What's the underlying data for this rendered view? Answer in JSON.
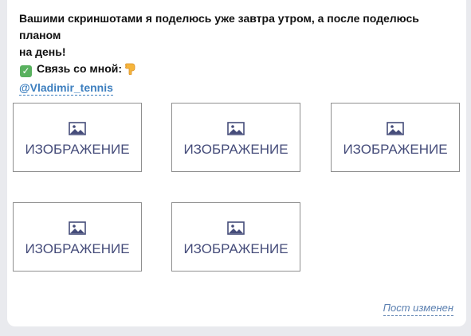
{
  "post": {
    "text_line1": "Вашими скриншотами я поделюсь уже завтра утром, а после поделюсь планом",
    "text_line2": "на день!",
    "contact_label": "Связь со мной:",
    "mention": "@Vladimir_tennis",
    "check_icon": "white-check-mark-icon",
    "hand_icon": "backhand-index-pointing-down-icon"
  },
  "images": [
    {
      "label": "ИЗОБРАЖЕНИЕ",
      "icon": "image-icon"
    },
    {
      "label": "ИЗОБРАЖЕНИЕ",
      "icon": "image-icon"
    },
    {
      "label": "ИЗОБРАЖЕНИЕ",
      "icon": "image-icon"
    },
    {
      "label": "ИЗОБРАЖЕНИЕ",
      "icon": "image-icon"
    },
    {
      "label": "ИЗОБРАЖЕНИЕ",
      "icon": "image-icon"
    }
  ],
  "footer": {
    "edited_label": "Пост изменен"
  },
  "colors": {
    "page_bg": "#e9eaee",
    "card_bg": "#ffffff",
    "link": "#3d7fbf",
    "image_label": "#454c7a",
    "check_green": "#59b15f"
  }
}
